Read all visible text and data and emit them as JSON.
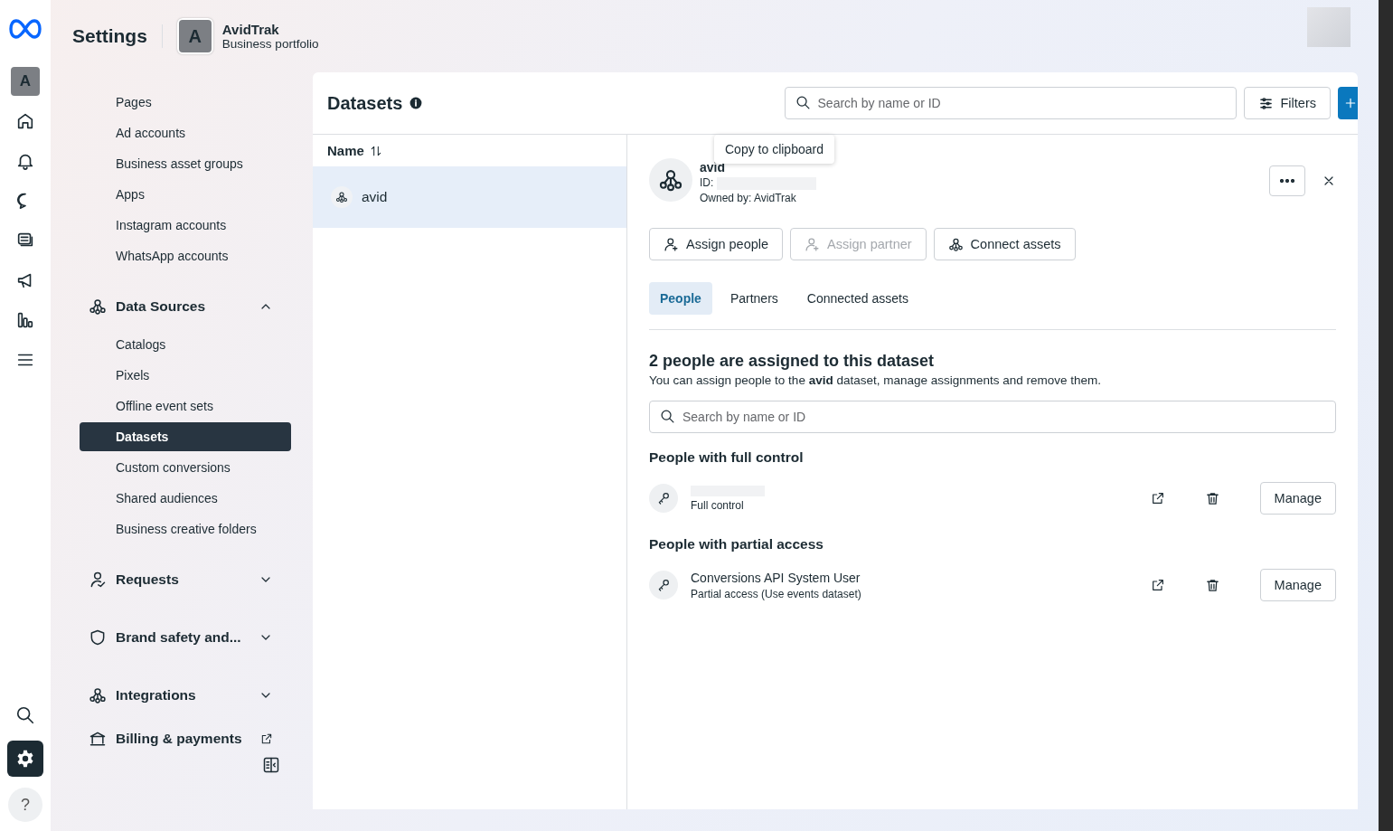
{
  "rail": {
    "top": [
      {
        "kind": "logo"
      },
      {
        "kind": "avatar",
        "initial": "A",
        "selected": false
      },
      {
        "kind": "home",
        "selected": false
      },
      {
        "kind": "bell",
        "selected": false
      },
      {
        "kind": "chat",
        "selected": false
      },
      {
        "kind": "pages",
        "selected": false
      },
      {
        "kind": "megaphone",
        "selected": false
      },
      {
        "kind": "chart",
        "selected": false
      },
      {
        "kind": "menu",
        "selected": false
      }
    ],
    "bottom": [
      {
        "kind": "search",
        "selected": false
      },
      {
        "kind": "settings",
        "selected": true
      },
      {
        "kind": "help",
        "label": "?",
        "selected": false
      }
    ]
  },
  "header": {
    "title": "Settings",
    "portfolio": {
      "initial": "A",
      "name": "AvidTrak",
      "subtitle": "Business portfolio"
    }
  },
  "sidebar": {
    "items": [
      {
        "label": "Pages",
        "selected": false
      },
      {
        "label": "Ad accounts",
        "selected": false
      },
      {
        "label": "Business asset groups",
        "selected": false
      },
      {
        "label": "Apps",
        "selected": false
      },
      {
        "label": "Instagram accounts",
        "selected": false
      },
      {
        "label": "WhatsApp accounts",
        "selected": false
      }
    ],
    "sections": [
      {
        "label": "Data Sources",
        "kind": "data",
        "external": false,
        "expanded": true,
        "children": [
          {
            "label": "Catalogs",
            "selected": false
          },
          {
            "label": "Pixels",
            "selected": false
          },
          {
            "label": "Offline event sets",
            "selected": false
          },
          {
            "label": "Datasets",
            "selected": true
          },
          {
            "label": "Custom conversions",
            "selected": false
          },
          {
            "label": "Shared audiences",
            "selected": false
          },
          {
            "label": "Business creative folders",
            "selected": false
          }
        ]
      },
      {
        "label": "Requests",
        "kind": "requests",
        "external": false,
        "expanded": false
      },
      {
        "label": "Brand safety and...",
        "kind": "shield",
        "external": false,
        "expanded": false
      },
      {
        "label": "Integrations",
        "kind": "data",
        "external": false,
        "expanded": false
      },
      {
        "label": "Billing & payments",
        "kind": "bank",
        "external": true
      }
    ]
  },
  "list": {
    "title": "Datasets",
    "search_placeholder": "Search by name or ID",
    "filters": "Filters",
    "column": "Name",
    "rows": [
      {
        "name": "avid",
        "selected": true
      }
    ]
  },
  "detail": {
    "tooltip": "Copy to clipboard",
    "name": "avid",
    "id_label": "ID:",
    "id_redacted": true,
    "owner": "Owned by: AvidTrak",
    "actions": [
      {
        "label": "Assign people",
        "kind": "person-add",
        "disabled": false
      },
      {
        "label": "Assign partner",
        "kind": "person-add",
        "disabled": true
      },
      {
        "label": "Connect assets",
        "kind": "data",
        "disabled": false
      }
    ],
    "tabs": [
      {
        "label": "People",
        "selected": true
      },
      {
        "label": "Partners",
        "selected": false
      },
      {
        "label": "Connected assets",
        "selected": false
      }
    ],
    "heading": "2 people are assigned to this dataset",
    "description": "You can assign people to the **avid** dataset, manage assignments and remove them.",
    "search_placeholder": "Search by name or ID",
    "groups": [
      {
        "title": "People with full control",
        "people": [
          {
            "redacted": true,
            "access": "Full control",
            "action": "Manage"
          }
        ]
      },
      {
        "title": "People with partial access",
        "people": [
          {
            "redacted": false,
            "name": "Conversions API System User",
            "access": "Partial access (Use events dataset)",
            "action": "Manage"
          }
        ]
      }
    ]
  }
}
